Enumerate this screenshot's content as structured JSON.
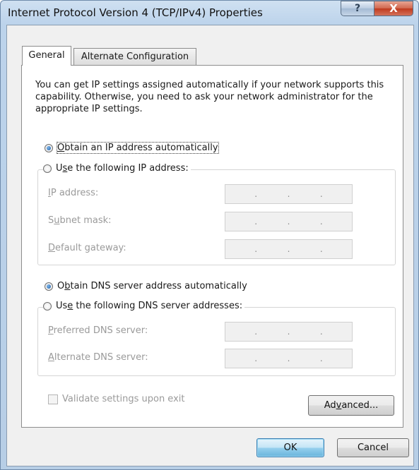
{
  "window": {
    "title": "Internet Protocol Version 4 (TCP/IPv4) Properties",
    "help_glyph": "?",
    "close_glyph": "X"
  },
  "tabs": [
    {
      "label": "General",
      "selected": true
    },
    {
      "label": "Alternate Configuration",
      "selected": false
    }
  ],
  "description": "You can get IP settings assigned automatically if your network supports this capability. Otherwise, you need to ask your network administrator for the appropriate IP settings.",
  "ip_section": {
    "auto_option": {
      "pre": "",
      "key": "O",
      "post": "btain an IP address automatically",
      "checked": true
    },
    "manual_option": {
      "pre": "U",
      "key": "s",
      "post": "e the following IP address:",
      "checked": false
    },
    "fields": [
      {
        "pre": "",
        "key": "I",
        "post": "P address:",
        "dots": [
          ".",
          ".",
          "."
        ]
      },
      {
        "pre": "S",
        "key": "u",
        "post": "bnet mask:",
        "dots": [
          ".",
          ".",
          "."
        ]
      },
      {
        "pre": "",
        "key": "D",
        "post": "efault gateway:",
        "dots": [
          ".",
          ".",
          "."
        ]
      }
    ]
  },
  "dns_section": {
    "auto_option": {
      "pre": "O",
      "key": "b",
      "post": "tain DNS server address automatically",
      "checked": true
    },
    "manual_option": {
      "pre": "Us",
      "key": "e",
      "post": " the following DNS server addresses:",
      "checked": false
    },
    "fields": [
      {
        "pre": "",
        "key": "P",
        "post": "referred DNS server:",
        "dots": [
          ".",
          ".",
          "."
        ]
      },
      {
        "pre": "",
        "key": "A",
        "post": "lternate DNS server:",
        "dots": [
          ".",
          ".",
          "."
        ]
      }
    ]
  },
  "validate": {
    "label": "Validate settings upon exit",
    "checked": false
  },
  "buttons": {
    "advanced": {
      "pre": "Ad",
      "key": "v",
      "post": "anced..."
    },
    "ok": "OK",
    "cancel": "Cancel"
  }
}
